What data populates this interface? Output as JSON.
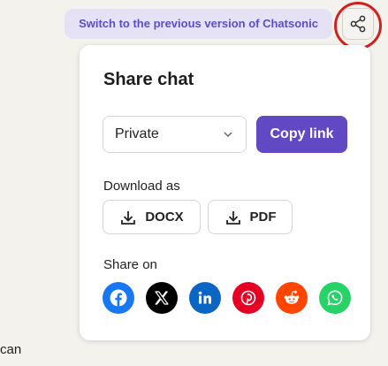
{
  "top_banner": {
    "switch_label": "Switch to the previous version of Chatsonic"
  },
  "share_trigger": {
    "icon": "share-icon"
  },
  "share_modal": {
    "title": "Share chat",
    "privacy": {
      "selected": "Private",
      "icon": "chevron-down-icon"
    },
    "copy_link_label": "Copy link",
    "download": {
      "label": "Download as",
      "options": [
        {
          "label": "DOCX",
          "icon": "download-icon"
        },
        {
          "label": "PDF",
          "icon": "download-icon"
        }
      ]
    },
    "share_on": {
      "label": "Share on",
      "networks": [
        {
          "name": "Facebook",
          "color": "#1877f2"
        },
        {
          "name": "X",
          "color": "#000000"
        },
        {
          "name": "LinkedIn",
          "color": "#0a66c2"
        },
        {
          "name": "Pinterest",
          "color": "#e60023"
        },
        {
          "name": "Reddit",
          "color": "#ff4500"
        },
        {
          "name": "WhatsApp",
          "color": "#25d366"
        }
      ]
    }
  },
  "background_text": {
    "fragment": "can"
  },
  "colors": {
    "accent": "#6149c4",
    "highlight_ring": "#d0211c",
    "pill_background": "#e4e2f4",
    "pill_text": "#5b4fc9"
  }
}
